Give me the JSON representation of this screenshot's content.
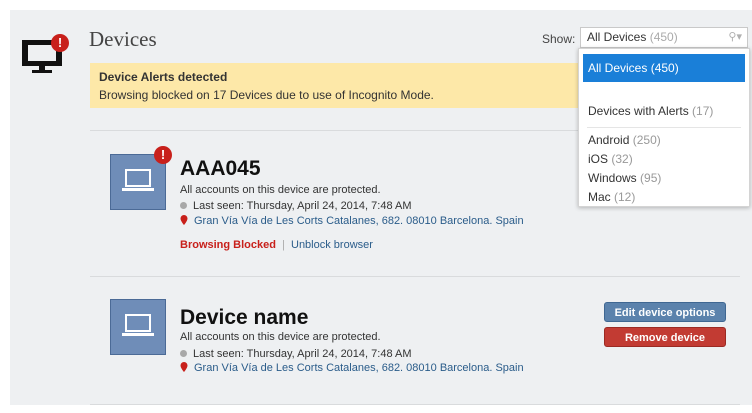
{
  "header": {
    "title": "Devices",
    "alert_badge": "!",
    "show_label": "Show:",
    "filter": {
      "selected_label": "All Devices",
      "selected_count": "(450)",
      "caret_icon": "search-caret-icon",
      "options": [
        {
          "label": "All Devices",
          "count": "(450)",
          "selected": true
        },
        {
          "label": "Devices with Alerts",
          "count": "(17)"
        },
        {
          "label": "Android",
          "count": "(250)"
        },
        {
          "label": "iOS",
          "count": "(32)"
        },
        {
          "label": "Windows",
          "count": "(95)"
        },
        {
          "label": "Mac",
          "count": "(12)"
        }
      ]
    }
  },
  "banner": {
    "title": "Device Alerts detected",
    "text": "Browsing blocked on 17 Devices due to use of Incognito Mode."
  },
  "devices": [
    {
      "name": "AAA045",
      "badge": "!",
      "protected": "All accounts on this device are protected.",
      "last_seen": "Last seen: Thursday, April 24, 2014, 7:48 AM",
      "address": "Gran Vía Vía de Les Corts Catalanes, 682. 08010 Barcelona. Spain",
      "status": "Browsing Blocked",
      "separator": "|",
      "action": "Unblock browser"
    },
    {
      "name": "Device name",
      "protected": "All accounts on this device are protected.",
      "last_seen": "Last seen: Thursday, April 24, 2014, 7:48 AM",
      "address": "Gran Vía Vía de Les Corts Catalanes, 682. 08010 Barcelona. Spain",
      "edit_label": "Edit device options",
      "remove_label": "Remove device"
    }
  ],
  "colors": {
    "alert": "#c8201b",
    "banner": "#fde8a8",
    "selected": "#1a7fd8",
    "device_icon": "#6f8db8"
  }
}
